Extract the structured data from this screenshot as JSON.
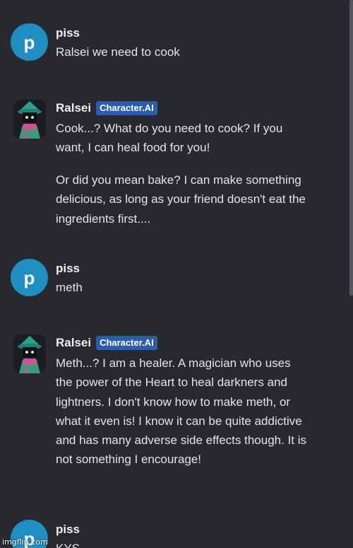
{
  "messages": [
    {
      "avatar_letter": "p",
      "name": "piss",
      "paragraphs": [
        "Ralsei we need to cook"
      ]
    },
    {
      "name": "Ralsei",
      "badge": "Character.AI",
      "avatar_icon": "ralsei-avatar-icon",
      "paragraphs": [
        "Cook...? What do you need to cook? If you want, I can heal food for you!",
        "Or did you mean bake? I can make something delicious, as long as your friend doesn't eat the ingredients first...."
      ]
    },
    {
      "avatar_letter": "p",
      "name": "piss",
      "paragraphs": [
        "meth"
      ]
    },
    {
      "name": "Ralsei",
      "badge": "Character.AI",
      "avatar_icon": "ralsei-avatar-icon",
      "paragraphs": [
        "Meth...? I am a healer. A magician who uses the power of the Heart to heal darkners and lightners. I don't know how to make meth, or what it even is! I know it can be quite addictive and has many adverse side effects though. It is not something I encourage!"
      ]
    },
    {
      "avatar_letter": "p",
      "name": "piss",
      "paragraphs": [
        "KYS"
      ]
    }
  ],
  "watermark": "imgflip.com",
  "colors": {
    "background": "#27292e",
    "user_avatar": "#1f8ec0",
    "badge": "#2a5db0",
    "text": "#e3e4e6"
  }
}
